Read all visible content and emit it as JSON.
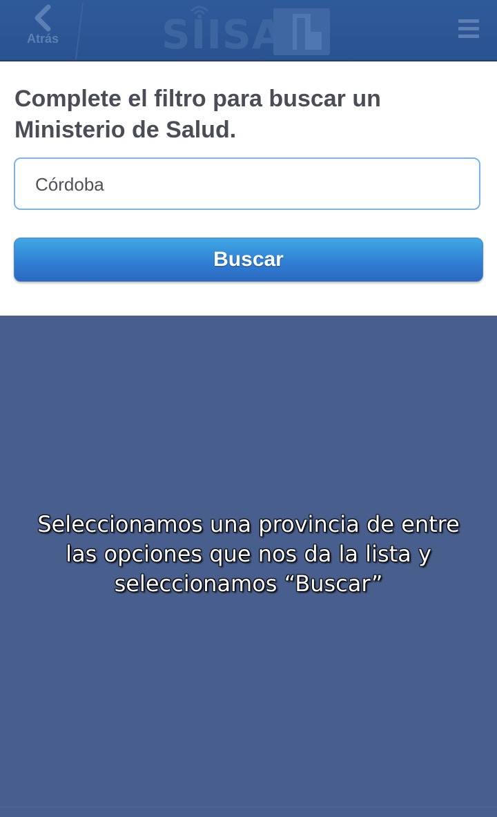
{
  "header": {
    "back_label": "Atrás",
    "logo_text": "SIISA",
    "icons": {
      "back": "chevron-left-icon",
      "menu": "hamburger-menu-icon"
    }
  },
  "form": {
    "heading": "Complete el filtro para buscar un Ministerio de Salud.",
    "province_value": "Córdoba",
    "search_button": "Buscar"
  },
  "overlay": {
    "caption": "Seleccionamos una provincia de entre las opciones que nos da la lista y seleccionamos “Buscar”"
  },
  "colors": {
    "header": "#2c5594",
    "panel": "#ffffff",
    "overlay_bg": "#485e8c",
    "button_top": "#3fa8e4",
    "button_bottom": "#2a69bf",
    "field_border": "#79b4ea",
    "heading_text": "#4a4d55"
  }
}
